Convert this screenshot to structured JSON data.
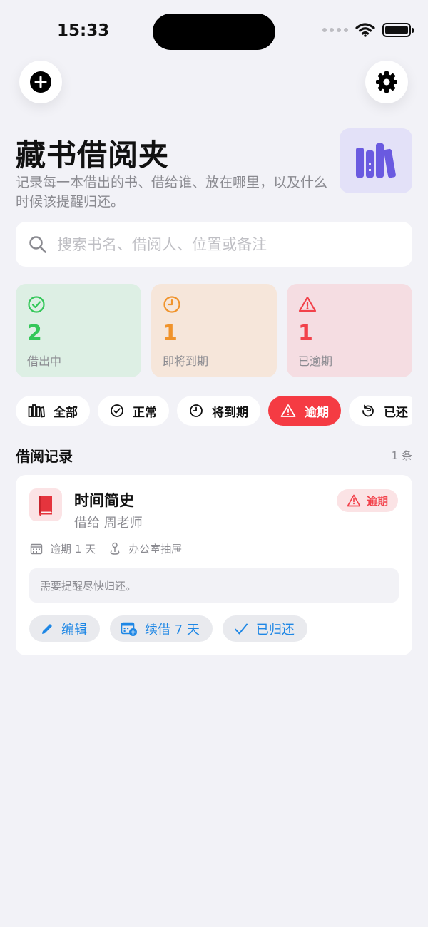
{
  "status_bar": {
    "time": "15:33"
  },
  "header": {
    "title": "藏书借阅夹",
    "subtitle": "记录每一本借出的书、借给谁、放在哪里，以及什么时候该提醒归还。"
  },
  "search": {
    "placeholder": "搜索书名、借阅人、位置或备注",
    "value": ""
  },
  "stats": [
    {
      "value": "2",
      "label": "借出中",
      "color": "#34C759"
    },
    {
      "value": "1",
      "label": "即将到期",
      "color": "#F0932B"
    },
    {
      "value": "1",
      "label": "已逾期",
      "color": "#F2424B"
    }
  ],
  "filters": [
    {
      "label": "全部",
      "icon": "library-icon",
      "active": false
    },
    {
      "label": "正常",
      "icon": "check-circle-icon",
      "active": false
    },
    {
      "label": "将到期",
      "icon": "clock-icon",
      "active": false
    },
    {
      "label": "逾期",
      "icon": "warning-icon",
      "active": true
    },
    {
      "label": "已还",
      "icon": "return-icon",
      "active": false
    }
  ],
  "records_section": {
    "title": "借阅记录",
    "count": "1 条"
  },
  "record": {
    "book_title": "时间简史",
    "borrower": "借给 周老师",
    "badge": "逾期",
    "due": "逾期 1 天",
    "location": "办公室抽屉",
    "note": "需要提醒尽快归还。",
    "actions": {
      "edit": "编辑",
      "renew": "续借 7 天",
      "returned": "已归还"
    }
  },
  "colors": {
    "accent": "#1E87E5",
    "danger": "#F53B43",
    "background": "#F2F2F7"
  }
}
